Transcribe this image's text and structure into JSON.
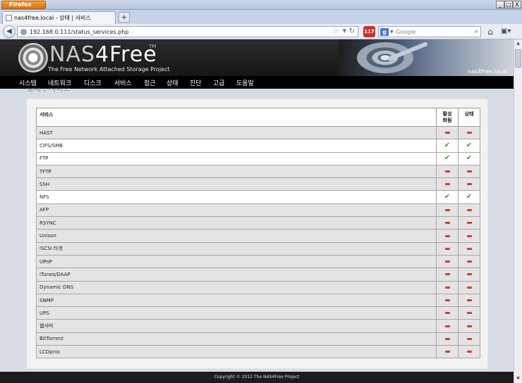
{
  "browser": {
    "menu_label": "Firefox",
    "tab_title": "nas4free.local - 상태 | 서비스",
    "new_tab_label": "+",
    "url": "192.168.0.111/status_services.php",
    "search_placeholder": "Google",
    "addon_badge": "117",
    "window_buttons": {
      "minimize": "_",
      "maximize": "□",
      "close": "X"
    }
  },
  "header": {
    "logo_main": "NAS",
    "logo_accent": "4Free",
    "logo_tm": "TM",
    "tagline": "The Free Network Attached Storage Project",
    "hostname": "nas4free.local"
  },
  "menu": [
    "시스템",
    "네트워크",
    "디스크",
    "서비스",
    "접근",
    "상태",
    "진단",
    "고급",
    "도움말"
  ],
  "page_subtitle": "상태 | 서비스",
  "table": {
    "headers": {
      "service": "서비스",
      "enabled": "활성\n화됨",
      "status": "상태"
    },
    "rows": [
      {
        "name": "HAST",
        "enabled": false,
        "running": false
      },
      {
        "name": "CIFS/SMB",
        "enabled": true,
        "running": true
      },
      {
        "name": "FTP",
        "enabled": true,
        "running": true
      },
      {
        "name": "TFTP",
        "enabled": false,
        "running": false
      },
      {
        "name": "SSH",
        "enabled": false,
        "running": false
      },
      {
        "name": "NFS",
        "enabled": true,
        "running": true
      },
      {
        "name": "AFP",
        "enabled": false,
        "running": false
      },
      {
        "name": "RSYNC",
        "enabled": false,
        "running": false
      },
      {
        "name": "Unison",
        "enabled": false,
        "running": false
      },
      {
        "name": "iSCSI 타겟",
        "enabled": false,
        "running": false
      },
      {
        "name": "UPnP",
        "enabled": false,
        "running": false
      },
      {
        "name": "iTunes/DAAP",
        "enabled": false,
        "running": false
      },
      {
        "name": "Dynamic DNS",
        "enabled": false,
        "running": false
      },
      {
        "name": "SNMP",
        "enabled": false,
        "running": false
      },
      {
        "name": "UPS",
        "enabled": false,
        "running": false
      },
      {
        "name": "웹서버",
        "enabled": false,
        "running": false
      },
      {
        "name": "BitTorrent",
        "enabled": false,
        "running": false
      },
      {
        "name": "LCDproc",
        "enabled": false,
        "running": false
      }
    ]
  },
  "footer": {
    "copyright": "Copyright © 2012 The NAS4Free Project"
  },
  "colors": {
    "status_off": "#d63b2f",
    "status_on": "#3a9b1c",
    "header_bg": "#1c1c1c"
  }
}
